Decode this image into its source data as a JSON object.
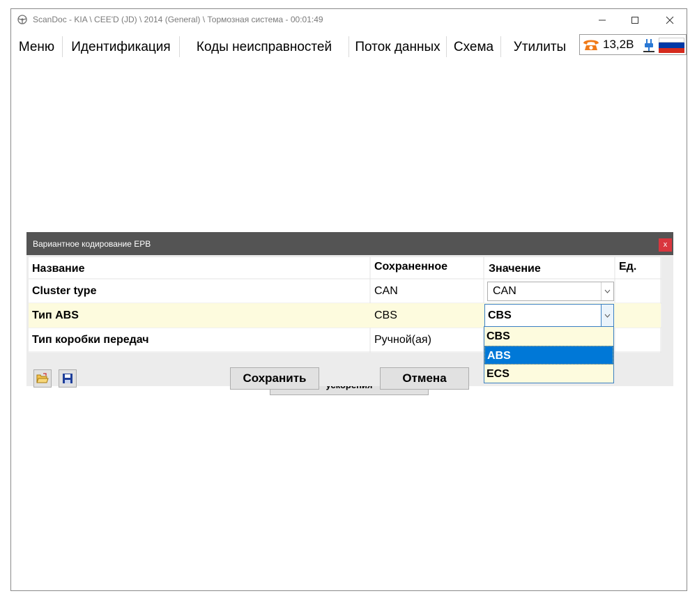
{
  "window": {
    "title": "ScanDoc - KIA \\ CEE'D (JD) \\ 2014 (General) \\ Тормозная система - 00:01:49"
  },
  "tabs": [
    {
      "label": "Меню"
    },
    {
      "label": "Идентификация"
    },
    {
      "label": "Коды неисправностей"
    },
    {
      "label": "Поток данных"
    },
    {
      "label": "Схема"
    },
    {
      "label": "Утилиты"
    }
  ],
  "status": {
    "voltage": "13,2В",
    "icons": [
      "phone-icon",
      "plug-icon",
      "russian-flag-icon"
    ],
    "colors": {
      "phone": "#f07a18",
      "plug": "#2a78d4",
      "flag_white": "#ffffff",
      "flag_blue": "#0039a6",
      "flag_red": "#d52b1e"
    }
  },
  "background": {
    "button_label": "ускорения"
  },
  "dialog": {
    "title": "Вариантное кодирование EPB",
    "close_label": "x",
    "columns": {
      "name": "Название",
      "saved": "Сохраненное",
      "value": "Значение",
      "unit": "Ед."
    },
    "rows": [
      {
        "name": "Cluster type",
        "saved": "CAN",
        "value": "CAN"
      },
      {
        "name": "Тип ABS",
        "saved": "CBS",
        "value": "CBS"
      },
      {
        "name": "Тип коробки передач",
        "saved": "Ручной(ая)",
        "value": ""
      }
    ],
    "dropdown": {
      "options": [
        "CBS",
        "ABS",
        "ECS"
      ],
      "highlighted": "ABS"
    },
    "buttons": {
      "save": "Сохранить",
      "cancel": "Отмена"
    },
    "toolbar_icons": [
      "open-folder-icon",
      "floppy-disk-icon"
    ],
    "colors": {
      "highlight_row": "#fdfbde",
      "selection": "#0078d7",
      "title_bar": "#545454",
      "close": "#d9363e"
    }
  }
}
